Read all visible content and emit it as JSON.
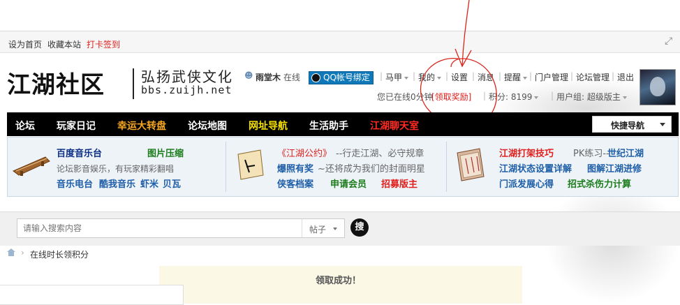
{
  "topbar": {
    "set_homepage": "设为首页",
    "bookmark": "收藏本站",
    "checkin": "打卡签到"
  },
  "brand": {
    "logo": "江湖社区",
    "slogan": "弘扬武侠文化",
    "domain": "bbs.zuijh.net"
  },
  "user": {
    "name": "雨堂木",
    "status": "在线",
    "qq_bind": "QQ帐号绑定",
    "menu": [
      "马甲",
      "我的",
      "设置",
      "消息",
      "提醒",
      "门户管理",
      "论坛管理",
      "退出"
    ],
    "online_time": "您已在线0分钟",
    "claim_reward": "[领取奖励]",
    "points_label": "积分: 8199",
    "group_label": "用户组: 超级版主"
  },
  "nav": {
    "items": [
      "论坛",
      "玩家日记",
      "幸运大转盘",
      "论坛地图",
      "网址导航",
      "生活助手",
      "江湖聊天室"
    ],
    "quick_nav": "快捷导航"
  },
  "promo": {
    "col1": {
      "title": "百度音乐台",
      "tag": "图片压缩",
      "desc": "论坛影音娱乐，有玩家精彩翻唱",
      "links": [
        "音乐电台",
        "酷我音乐",
        "虾米",
        "贝瓦"
      ]
    },
    "col2": {
      "title": "《江湖公约》",
      "title_desc": "--行走江湖、必守规章",
      "news": "爆照有奖",
      "news_desc": "~还将成为我们的封面明星",
      "links": [
        "侠客档案",
        "申请会员",
        "招募版主"
      ]
    },
    "col3": {
      "title": "江湖打架技巧",
      "pk": "PK练习--",
      "pk_link": "世纪江湖",
      "row2": [
        "江湖状态设置详解",
        "图解江湖进修"
      ],
      "row3": [
        "门派发展心得",
        "招式杀伤力计算"
      ]
    }
  },
  "search": {
    "placeholder": "请输入搜索内容",
    "type": "帖子",
    "button": "搜"
  },
  "breadcrumb": {
    "current": "在线时长领积分"
  },
  "notice": {
    "message": "领取成功！"
  },
  "colors": {
    "nav_bg": "#000000",
    "link_blue": "#1f5fa7",
    "highlight_red": "#e0201c",
    "gold": "#f5a623",
    "yellow": "#f5e100"
  },
  "icons": [
    "user-icon",
    "qq-penguin-icon",
    "chevron-down-icon",
    "home-icon",
    "search-icon",
    "fullscreen-icon"
  ]
}
